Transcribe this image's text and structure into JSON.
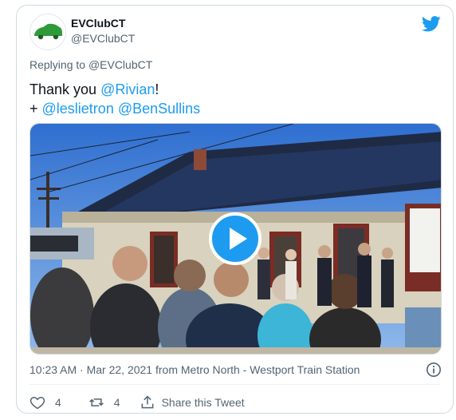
{
  "tweet": {
    "author_name": "EVClubCT",
    "author_handle": "@EVClubCT",
    "avatar_logo_text": "EVClubCT",
    "replying_prefix": "Replying to",
    "replying_to": "@EVClubCT",
    "line1_prefix": "Thank you ",
    "line1_mention": "@Rivian",
    "line1_suffix": "!",
    "line2_prefix": "+ ",
    "line2_mention1": "@leslietron",
    "line2_mention2": "@BenSullins",
    "timestamp": "10:23 AM · Mar 22, 2021 from Metro North - Westport Train Station"
  },
  "actions": {
    "like_count": "4",
    "retweet_count": "4",
    "share_label": "Share this Tweet"
  },
  "colors": {
    "accent": "#1d9bf0",
    "secondary_text": "#536471",
    "border": "#cfd9de",
    "logo_green": "#2f9a3a"
  },
  "icons": {
    "brand": "twitter-bird-icon",
    "play": "play-icon",
    "info": "info-icon",
    "like": "heart-icon",
    "retweet": "retweet-icon",
    "share": "share-icon"
  }
}
